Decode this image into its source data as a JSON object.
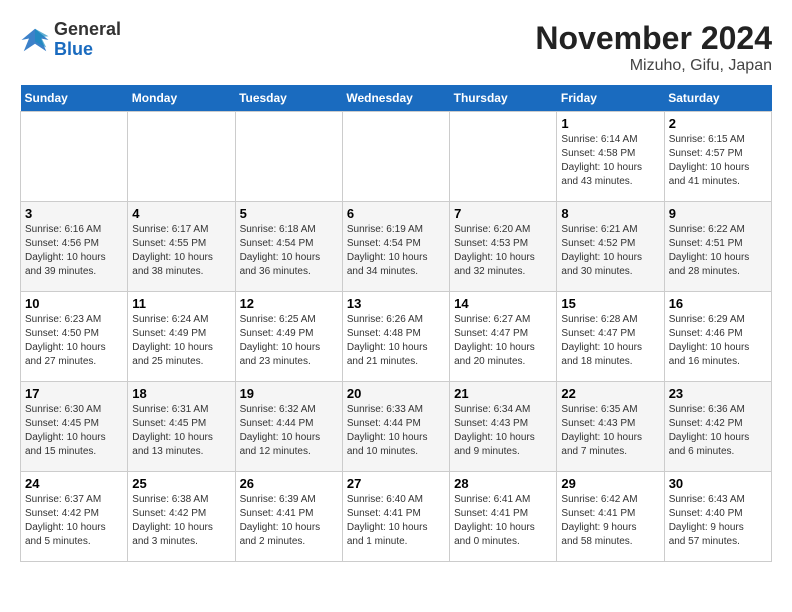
{
  "header": {
    "logo_general": "General",
    "logo_blue": "Blue",
    "month_title": "November 2024",
    "location": "Mizuho, Gifu, Japan"
  },
  "weekdays": [
    "Sunday",
    "Monday",
    "Tuesday",
    "Wednesday",
    "Thursday",
    "Friday",
    "Saturday"
  ],
  "weeks": [
    [
      {
        "day": "",
        "info": ""
      },
      {
        "day": "",
        "info": ""
      },
      {
        "day": "",
        "info": ""
      },
      {
        "day": "",
        "info": ""
      },
      {
        "day": "",
        "info": ""
      },
      {
        "day": "1",
        "info": "Sunrise: 6:14 AM\nSunset: 4:58 PM\nDaylight: 10 hours\nand 43 minutes."
      },
      {
        "day": "2",
        "info": "Sunrise: 6:15 AM\nSunset: 4:57 PM\nDaylight: 10 hours\nand 41 minutes."
      }
    ],
    [
      {
        "day": "3",
        "info": "Sunrise: 6:16 AM\nSunset: 4:56 PM\nDaylight: 10 hours\nand 39 minutes."
      },
      {
        "day": "4",
        "info": "Sunrise: 6:17 AM\nSunset: 4:55 PM\nDaylight: 10 hours\nand 38 minutes."
      },
      {
        "day": "5",
        "info": "Sunrise: 6:18 AM\nSunset: 4:54 PM\nDaylight: 10 hours\nand 36 minutes."
      },
      {
        "day": "6",
        "info": "Sunrise: 6:19 AM\nSunset: 4:54 PM\nDaylight: 10 hours\nand 34 minutes."
      },
      {
        "day": "7",
        "info": "Sunrise: 6:20 AM\nSunset: 4:53 PM\nDaylight: 10 hours\nand 32 minutes."
      },
      {
        "day": "8",
        "info": "Sunrise: 6:21 AM\nSunset: 4:52 PM\nDaylight: 10 hours\nand 30 minutes."
      },
      {
        "day": "9",
        "info": "Sunrise: 6:22 AM\nSunset: 4:51 PM\nDaylight: 10 hours\nand 28 minutes."
      }
    ],
    [
      {
        "day": "10",
        "info": "Sunrise: 6:23 AM\nSunset: 4:50 PM\nDaylight: 10 hours\nand 27 minutes."
      },
      {
        "day": "11",
        "info": "Sunrise: 6:24 AM\nSunset: 4:49 PM\nDaylight: 10 hours\nand 25 minutes."
      },
      {
        "day": "12",
        "info": "Sunrise: 6:25 AM\nSunset: 4:49 PM\nDaylight: 10 hours\nand 23 minutes."
      },
      {
        "day": "13",
        "info": "Sunrise: 6:26 AM\nSunset: 4:48 PM\nDaylight: 10 hours\nand 21 minutes."
      },
      {
        "day": "14",
        "info": "Sunrise: 6:27 AM\nSunset: 4:47 PM\nDaylight: 10 hours\nand 20 minutes."
      },
      {
        "day": "15",
        "info": "Sunrise: 6:28 AM\nSunset: 4:47 PM\nDaylight: 10 hours\nand 18 minutes."
      },
      {
        "day": "16",
        "info": "Sunrise: 6:29 AM\nSunset: 4:46 PM\nDaylight: 10 hours\nand 16 minutes."
      }
    ],
    [
      {
        "day": "17",
        "info": "Sunrise: 6:30 AM\nSunset: 4:45 PM\nDaylight: 10 hours\nand 15 minutes."
      },
      {
        "day": "18",
        "info": "Sunrise: 6:31 AM\nSunset: 4:45 PM\nDaylight: 10 hours\nand 13 minutes."
      },
      {
        "day": "19",
        "info": "Sunrise: 6:32 AM\nSunset: 4:44 PM\nDaylight: 10 hours\nand 12 minutes."
      },
      {
        "day": "20",
        "info": "Sunrise: 6:33 AM\nSunset: 4:44 PM\nDaylight: 10 hours\nand 10 minutes."
      },
      {
        "day": "21",
        "info": "Sunrise: 6:34 AM\nSunset: 4:43 PM\nDaylight: 10 hours\nand 9 minutes."
      },
      {
        "day": "22",
        "info": "Sunrise: 6:35 AM\nSunset: 4:43 PM\nDaylight: 10 hours\nand 7 minutes."
      },
      {
        "day": "23",
        "info": "Sunrise: 6:36 AM\nSunset: 4:42 PM\nDaylight: 10 hours\nand 6 minutes."
      }
    ],
    [
      {
        "day": "24",
        "info": "Sunrise: 6:37 AM\nSunset: 4:42 PM\nDaylight: 10 hours\nand 5 minutes."
      },
      {
        "day": "25",
        "info": "Sunrise: 6:38 AM\nSunset: 4:42 PM\nDaylight: 10 hours\nand 3 minutes."
      },
      {
        "day": "26",
        "info": "Sunrise: 6:39 AM\nSunset: 4:41 PM\nDaylight: 10 hours\nand 2 minutes."
      },
      {
        "day": "27",
        "info": "Sunrise: 6:40 AM\nSunset: 4:41 PM\nDaylight: 10 hours\nand 1 minute."
      },
      {
        "day": "28",
        "info": "Sunrise: 6:41 AM\nSunset: 4:41 PM\nDaylight: 10 hours\nand 0 minutes."
      },
      {
        "day": "29",
        "info": "Sunrise: 6:42 AM\nSunset: 4:41 PM\nDaylight: 9 hours\nand 58 minutes."
      },
      {
        "day": "30",
        "info": "Sunrise: 6:43 AM\nSunset: 4:40 PM\nDaylight: 9 hours\nand 57 minutes."
      }
    ]
  ]
}
